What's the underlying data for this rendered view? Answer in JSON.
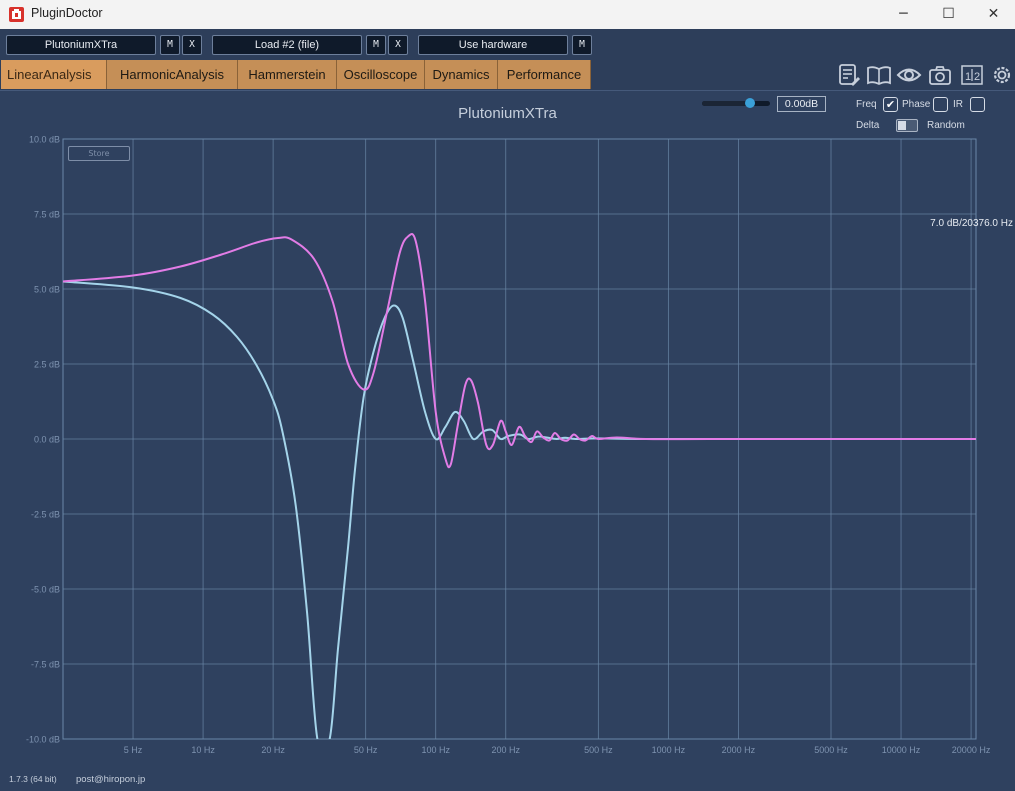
{
  "window": {
    "title": "PluginDoctor",
    "minimize": "─",
    "maximize": "☐",
    "close": "✕"
  },
  "toolbar": {
    "plugin1": "PlutoniumXTra",
    "plugin2": "Load #2 (file)",
    "hardware": "Use hardware",
    "m": "M",
    "x": "X"
  },
  "tabs": [
    "LinearAnalysis",
    "HarmonicAnalysis",
    "Hammerstein",
    "Oscilloscope",
    "Dynamics",
    "Performance"
  ],
  "tool_icons": [
    "notes-icon",
    "book-icon",
    "eye-icon",
    "camera-icon",
    "compare-1-2-icon",
    "gear-icon"
  ],
  "controls": {
    "gain_value": "0.00dB",
    "gain_slider_fraction": 0.7,
    "freq_label": "Freq",
    "phase_label": "Phase",
    "ir_label": "IR",
    "delta_label": "Delta",
    "random_label": "Random",
    "freq_checked": true,
    "phase_checked": false,
    "ir_checked": false,
    "check_mark": "✔"
  },
  "readout": "7.0 dB/20376.0 Hz",
  "store_label": "Store",
  "footer": {
    "version": "1.7.3 (64 bit)",
    "email": "post@hiropon.jp"
  },
  "colors": {
    "series_pink": "#e27ce6",
    "series_blue": "#a4d4ea",
    "grid": "#6b88a8",
    "tab": "#c58f57"
  },
  "chart_data": {
    "type": "line",
    "title": "PlutoniumXTra",
    "xscale": "log",
    "xlim": [
      2.5,
      21000
    ],
    "ylim": [
      -10,
      10
    ],
    "x_ticks": [
      5,
      10,
      20,
      50,
      100,
      200,
      500,
      1000,
      2000,
      5000,
      10000,
      20000
    ],
    "x_tick_labels": [
      "5 Hz",
      "10 Hz",
      "20 Hz",
      "50 Hz",
      "100 Hz",
      "200 Hz",
      "500 Hz",
      "1000 Hz",
      "2000 Hz",
      "5000 Hz",
      "10000 Hz",
      "20000 Hz"
    ],
    "y_ticks": [
      10,
      7.5,
      5,
      2.5,
      0,
      -2.5,
      -5,
      -7.5,
      -10
    ],
    "y_tick_labels": [
      "10.0 dB",
      "7.5 dB",
      "5.0 dB",
      "2.5 dB",
      "0.0 dB",
      "-2.5 dB",
      "-5.0 dB",
      "-7.5 dB",
      "-10.0 dB"
    ],
    "grid": true,
    "series": [
      {
        "color": "#e27ce6",
        "points": [
          [
            2.5,
            5.25
          ],
          [
            5,
            5.45
          ],
          [
            8,
            5.75
          ],
          [
            12,
            6.15
          ],
          [
            17,
            6.55
          ],
          [
            21,
            6.7
          ],
          [
            24,
            6.65
          ],
          [
            30,
            6.0
          ],
          [
            36,
            4.6
          ],
          [
            42,
            2.5
          ],
          [
            49,
            1.65
          ],
          [
            54,
            2.2
          ],
          [
            62,
            4.3
          ],
          [
            70,
            6.2
          ],
          [
            76,
            6.75
          ],
          [
            82,
            6.6
          ],
          [
            90,
            4.6
          ],
          [
            100,
            0.9
          ],
          [
            110,
            -0.65
          ],
          [
            116,
            -0.85
          ],
          [
            124,
            0.4
          ],
          [
            134,
            1.8
          ],
          [
            142,
            1.95
          ],
          [
            152,
            1.2
          ],
          [
            165,
            -0.2
          ],
          [
            176,
            -0.2
          ],
          [
            190,
            0.6
          ],
          [
            200,
            0.25
          ],
          [
            212,
            -0.2
          ],
          [
            228,
            0.4
          ],
          [
            242,
            0.1
          ],
          [
            258,
            -0.1
          ],
          [
            272,
            0.25
          ],
          [
            290,
            0.05
          ],
          [
            308,
            -0.05
          ],
          [
            325,
            0.2
          ],
          [
            345,
            0.0
          ],
          [
            368,
            -0.05
          ],
          [
            392,
            0.15
          ],
          [
            415,
            0.0
          ],
          [
            440,
            -0.05
          ],
          [
            470,
            0.1
          ],
          [
            500,
            0.0
          ],
          [
            600,
            0.05
          ],
          [
            800,
            0.0
          ],
          [
            1500,
            0.0
          ],
          [
            5000,
            0.0
          ],
          [
            21000,
            0.0
          ]
        ]
      },
      {
        "color": "#a4d4ea",
        "points": [
          [
            2.5,
            5.25
          ],
          [
            5,
            5.05
          ],
          [
            8,
            4.7
          ],
          [
            11,
            4.15
          ],
          [
            14,
            3.4
          ],
          [
            17,
            2.45
          ],
          [
            20,
            1.3
          ],
          [
            22,
            0.2
          ],
          [
            25,
            -2.2
          ],
          [
            28,
            -5.8
          ],
          [
            31,
            -10
          ],
          [
            35,
            -10
          ],
          [
            38,
            -7.0
          ],
          [
            42,
            -3.6
          ],
          [
            45,
            -1.0
          ],
          [
            49,
            1.4
          ],
          [
            54,
            2.9
          ],
          [
            60,
            4.0
          ],
          [
            66,
            4.45
          ],
          [
            72,
            4.05
          ],
          [
            80,
            2.6
          ],
          [
            90,
            0.9
          ],
          [
            100,
            0.0
          ],
          [
            110,
            0.4
          ],
          [
            121,
            0.9
          ],
          [
            132,
            0.6
          ],
          [
            145,
            0.0
          ],
          [
            160,
            0.25
          ],
          [
            175,
            0.3
          ],
          [
            190,
            0.0
          ],
          [
            205,
            0.1
          ],
          [
            230,
            0.15
          ],
          [
            250,
            0.0
          ],
          [
            275,
            0.08
          ],
          [
            300,
            0.05
          ],
          [
            330,
            0.0
          ],
          [
            360,
            0.04
          ],
          [
            400,
            0.0
          ],
          [
            500,
            0.02
          ],
          [
            800,
            0.0
          ],
          [
            5000,
            0.0
          ],
          [
            21000,
            0.0
          ]
        ]
      }
    ]
  }
}
